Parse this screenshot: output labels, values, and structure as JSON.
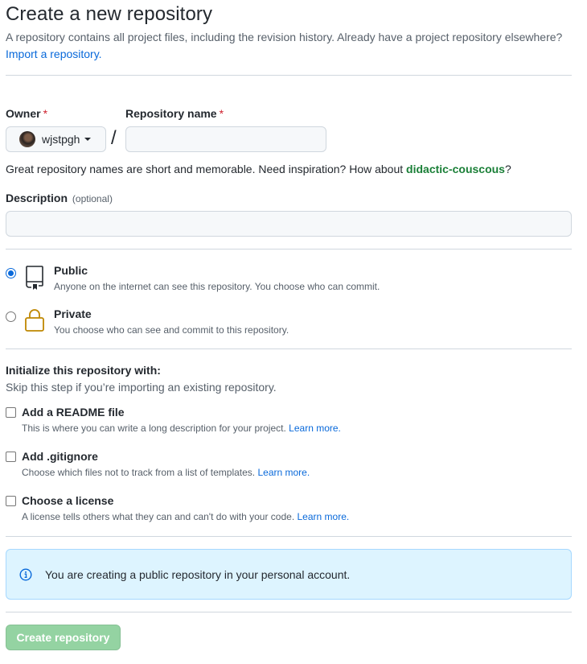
{
  "page": {
    "title": "Create a new repository",
    "subtitle": "A repository contains all project files, including the revision history. Already have a project repository elsewhere?",
    "import_link": "Import a repository."
  },
  "owner": {
    "label": "Owner",
    "required_mark": "*",
    "value": "wjstpgh"
  },
  "separator": "/",
  "repo_name": {
    "label": "Repository name",
    "required_mark": "*",
    "value": "",
    "placeholder": ""
  },
  "hint": {
    "text": "Great repository names are short and memorable. Need inspiration? How about",
    "suggestion": "didactic-couscous",
    "suffix": "?"
  },
  "description": {
    "label": "Description",
    "optional": "(optional)",
    "value": ""
  },
  "visibility": {
    "public": {
      "title": "Public",
      "desc": "Anyone on the internet can see this repository. You choose who can commit.",
      "icon": "repo-icon",
      "selected": true
    },
    "private": {
      "title": "Private",
      "desc": "You choose who can see and commit to this repository.",
      "icon": "lock-icon",
      "selected": false
    }
  },
  "initialize": {
    "title": "Initialize this repository with:",
    "subtitle": "Skip this step if you’re importing an existing repository.",
    "options": [
      {
        "title": "Add a README file",
        "desc": "This is where you can write a long description for your project.",
        "link": "Learn more.",
        "checked": false
      },
      {
        "title": "Add .gitignore",
        "desc": "Choose which files not to track from a list of templates.",
        "link": "Learn more.",
        "checked": false
      },
      {
        "title": "Choose a license",
        "desc": "A license tells others what they can and can't do with your code.",
        "link": "Learn more.",
        "checked": false
      }
    ]
  },
  "notice": {
    "icon": "info-icon",
    "text": "You are creating a public repository in your personal account."
  },
  "submit": {
    "label": "Create repository"
  },
  "colors": {
    "accent": "#0969da",
    "success": "#1a7f37",
    "button_disabled": "#94d3a2",
    "notice_bg": "#ddf4ff"
  }
}
